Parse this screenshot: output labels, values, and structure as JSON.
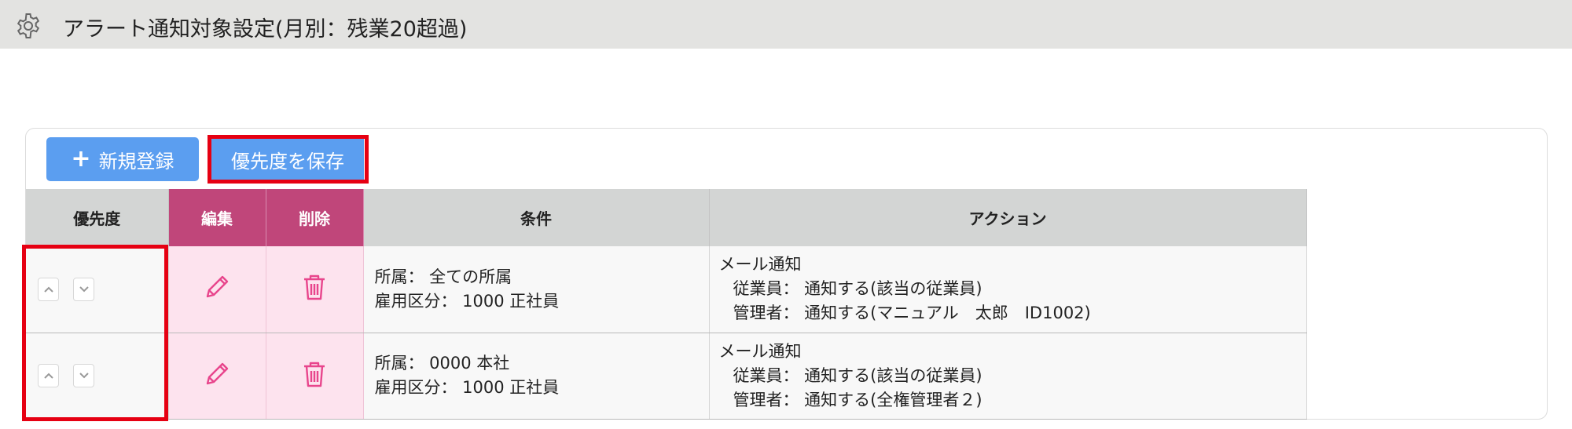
{
  "header": {
    "title": "アラート通知対象設定(月別：残業20超過)",
    "icon": "gear-icon"
  },
  "toolbar": {
    "new_plus": "+",
    "new_label": "新規登録",
    "save_priority_label": "優先度を保存"
  },
  "table": {
    "headers": {
      "priority": "優先度",
      "edit": "編集",
      "delete": "削除",
      "condition": "条件",
      "action": "アクション"
    },
    "rows": [
      {
        "cond_line1": "所属：  全ての所属",
        "cond_line2": "雇用区分：  1000 正社員",
        "action_title": "メール通知",
        "action_line1": "従業員：  通知する(該当の従業員)",
        "action_line2": "管理者：  通知する(マニュアル　太郎　ID1002)"
      },
      {
        "cond_line1": "所属：  0000 本社",
        "cond_line2": "雇用区分：  1000 正社員",
        "action_title": "メール通知",
        "action_line1": "従業員：  通知する(該当の従業員)",
        "action_line2": "管理者：  通知する(全権管理者２)"
      }
    ]
  },
  "colors": {
    "header_bg": "#e3e3e1",
    "button_blue": "#5b9ef0",
    "pink_header": "#c0467a",
    "pink_cell": "#fde3ee",
    "pink_icon": "#e8458c",
    "highlight_red": "#e60012"
  }
}
